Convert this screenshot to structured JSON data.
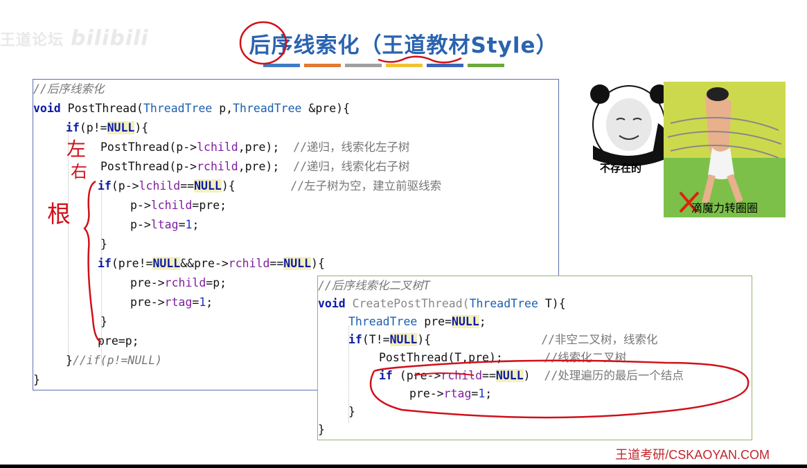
{
  "watermark": {
    "text": "王道论坛",
    "logo": "bilibili"
  },
  "title": "后序线索化（王道教材Style）",
  "title_bar_colors": [
    "#3f7cc4",
    "#e07a33",
    "#a0a0a0",
    "#f1c232",
    "#3b64b8",
    "#6aaa3c"
  ],
  "code1": {
    "comment": "//后序线索化",
    "sig_void": "void",
    "sig_name": " PostThread(",
    "sig_type1": "ThreadTree",
    "sig_p": " p,",
    "sig_type2": "ThreadTree",
    "sig_rest": " &pre){",
    "l3_if": "if",
    "l3_a": "(p!=",
    "l3_null": "NULL",
    "l3_b": "){",
    "l4_a": "PostThread(p->",
    "l4_field": "lchild",
    "l4_b": ",pre);  ",
    "l4_c": "//递归，线索化左子树",
    "l5_a": "PostThread(p->",
    "l5_field": "rchild",
    "l5_b": ",pre);  ",
    "l5_c": "//递归，线索化右子树",
    "l6_if": "if",
    "l6_a": "(p->",
    "l6_field": "lchild",
    "l6_b": "==",
    "l6_null": "NULL",
    "l6_c": "){        ",
    "l6_cm": "//左子树为空，建立前驱线索",
    "l7_a": "p->",
    "l7_field": "lchild",
    "l7_b": "=pre;",
    "l8_a": "p->",
    "l8_field": "ltag",
    "l8_b": "=",
    "l8_num": "1",
    "l8_c": ";",
    "l9": "}",
    "l10_if": "if",
    "l10_a": "(pre!=",
    "l10_null1": "NULL",
    "l10_b": "&&pre->",
    "l10_field": "rchild",
    "l10_c": "==",
    "l10_null2": "NULL",
    "l10_d": "){",
    "l11_a": "pre->",
    "l11_field": "rchild",
    "l11_b": "=p;",
    "l12_a": "pre->",
    "l12_field": "rtag",
    "l12_b": "=",
    "l12_num": "1",
    "l12_c": ";",
    "l13": "}",
    "l14": "pre=p;",
    "l15_a": "}",
    "l15_cm": "//if(p!=NULL)",
    "l16": "}"
  },
  "code2": {
    "comment": "//后序线索化二叉树T",
    "sig_void": "void",
    "sig_name": " CreatePostThread(",
    "sig_type": "ThreadTree",
    "sig_rest": " T){",
    "l3_type": "ThreadTree",
    "l3_a": " pre=",
    "l3_null": "NULL",
    "l3_b": ";",
    "l4_if": "if",
    "l4_a": "(T!=",
    "l4_null": "NULL",
    "l4_b": "){                ",
    "l4_cm": "//非空二叉树，线索化",
    "l5_a": "PostThread(T,pre);      ",
    "l5_cm": "//线索化二叉树",
    "l6_if": "if",
    "l6_a": " (pre->",
    "l6_field": "rchild",
    "l6_b": "==",
    "l6_null": "NULL",
    "l6_c": ")  ",
    "l6_cm": "//处理遍历的最后一个结点",
    "l7_a": "pre->",
    "l7_field": "rtag",
    "l7_b": "=",
    "l7_num": "1",
    "l7_c": ";",
    "l8": "}",
    "l9": "}"
  },
  "annotations": {
    "left": "左",
    "right": "右",
    "root": "根"
  },
  "meme1_caption": "不存在的",
  "meme2_caption": "滴魔力转圈圈",
  "footer": "王道考研/CSKAOYAN.COM"
}
